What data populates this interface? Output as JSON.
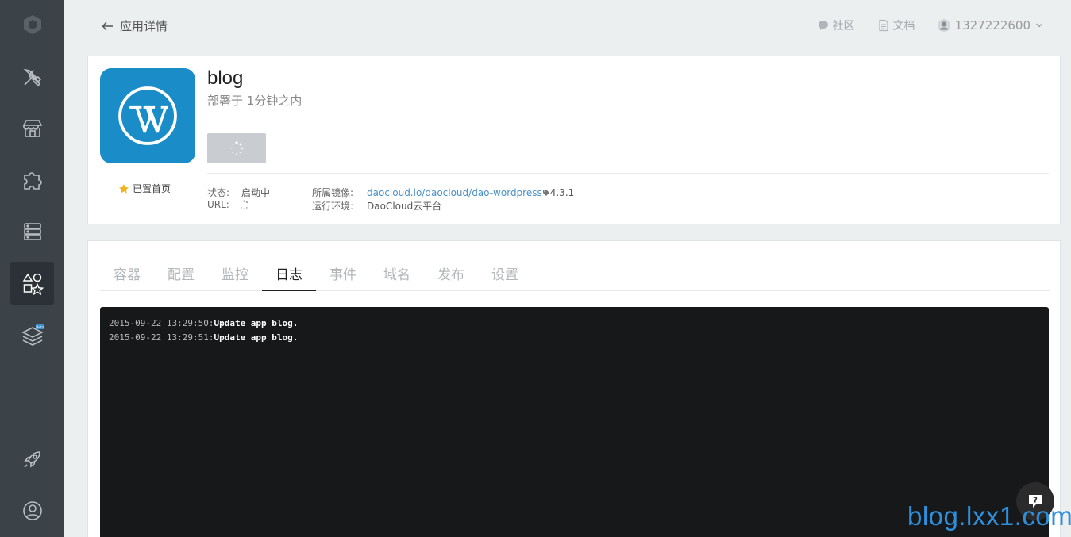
{
  "header": {
    "back_label": "应用详情",
    "community_label": "社区",
    "docs_label": "文档",
    "username": "1327222600"
  },
  "app": {
    "name": "blog",
    "deployed_text": "部署于 1分钟之内",
    "pin_label": "已置首页",
    "status_label": "状态:",
    "status_value": "启动中",
    "url_label": "URL:",
    "image_label": "所属镜像:",
    "image_value": "daocloud.io/daocloud/dao-wordpress",
    "image_tag": "4.3.1",
    "runtime_label": "运行环境:",
    "runtime_value": "DaoCloud云平台"
  },
  "tabs": [
    {
      "label": "容器"
    },
    {
      "label": "配置"
    },
    {
      "label": "监控"
    },
    {
      "label": "日志",
      "active": true
    },
    {
      "label": "事件"
    },
    {
      "label": "域名"
    },
    {
      "label": "发布"
    },
    {
      "label": "设置"
    }
  ],
  "logs": [
    {
      "timestamp": "2015-09-22 13:29:50:",
      "message": "Update app blog."
    },
    {
      "timestamp": "2015-09-22 13:29:51:",
      "message": "Update app blog."
    }
  ],
  "sidebar": {
    "beta_badge": "Beta"
  },
  "watermark": "blog.lxx1.com",
  "colors": {
    "sidebar": "#3b4248",
    "accent": "#1a8dc8",
    "link": "#4a90c9"
  }
}
